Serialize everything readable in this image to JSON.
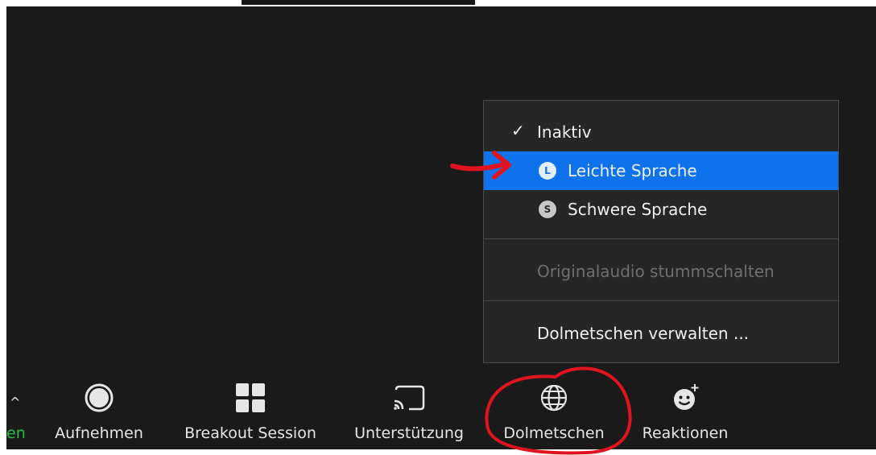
{
  "toolbar": {
    "partial_label": "en",
    "buttons": [
      {
        "label": "Aufnehmen",
        "icon": "record-icon"
      },
      {
        "label": "Breakout Session",
        "icon": "breakout-grid-icon"
      },
      {
        "label": "Unterstützung",
        "icon": "cast-screen-icon"
      },
      {
        "label": "Dolmetschen",
        "icon": "globe-icon"
      },
      {
        "label": "Reaktionen",
        "icon": "emoji-plus-icon"
      }
    ]
  },
  "interpretation_menu": {
    "items": [
      {
        "label": "Inaktiv",
        "checked": true
      },
      {
        "label": "Leichte Sprache",
        "badge": "L",
        "selected": true
      },
      {
        "label": "Schwere Sprache",
        "badge": "S"
      },
      {
        "label": "Originalaudio stummschalten",
        "disabled": true
      },
      {
        "label": "Dolmetschen verwalten ..."
      }
    ]
  },
  "colors": {
    "background": "#1a1a1a",
    "menu_background": "#262626",
    "selection": "#0e72ed",
    "annotation": "#e0141e",
    "active_green": "#29c04a"
  }
}
